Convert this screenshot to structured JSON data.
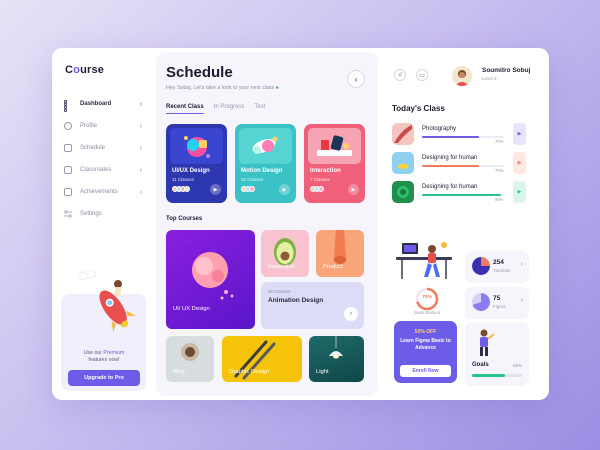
{
  "app": {
    "logo_prefix": "C",
    "logo_o": "o",
    "logo_suffix": "urse"
  },
  "sidebar": {
    "items": [
      {
        "label": "Dashboard",
        "icon": "dashboard-icon",
        "active": true
      },
      {
        "label": "Profile",
        "icon": "profile-icon"
      },
      {
        "label": "Schedule",
        "icon": "calendar-icon"
      },
      {
        "label": "Classmates",
        "icon": "users-icon"
      },
      {
        "label": "Achievements",
        "icon": "trophy-icon"
      },
      {
        "label": "Settings",
        "icon": "settings-icon"
      }
    ],
    "promo": {
      "text_before": "Use our ",
      "highlight": "Premium",
      "text_after": "features now!",
      "button": "Upgrade to Pro"
    }
  },
  "schedule": {
    "title": "Schedule",
    "subtitle": "Hey Sobuj, Let's take a look to your next class",
    "back_icon": "chevron-left-icon",
    "tabs": [
      "Recent Class",
      "In Progress",
      "Test"
    ],
    "recent_classes": [
      {
        "name": "UI/UX Design",
        "sub": "11 Classes",
        "color": "#2d37b0"
      },
      {
        "name": "Motion Design",
        "sub": "32 Classes",
        "color": "#3ac2c6"
      },
      {
        "name": "Interaction",
        "sub": "7 Classes",
        "color": "#f0607a"
      }
    ],
    "top_courses_title": "Top Courses",
    "top_courses": [
      {
        "label": "UI/ UX Design"
      },
      {
        "label": "Inspiration"
      },
      {
        "label": "Product"
      },
      {
        "small": "50 Classes",
        "label": "Animation Design"
      },
      {
        "label": "Blog"
      },
      {
        "label": "Graphic Design"
      },
      {
        "label": "Light"
      }
    ]
  },
  "header": {
    "notification_icon": "bell-icon",
    "message_icon": "chat-icon",
    "user_name": "Soumitro Sobuj",
    "user_level": "Level 3"
  },
  "today": {
    "title": "Today's Class",
    "classes": [
      {
        "name": "Photography",
        "progress": 70,
        "pct_label": "70%",
        "color": "#6c5ce7",
        "play_bg": "#e8e4fb"
      },
      {
        "name": "Designing for human",
        "progress": 70,
        "pct_label": "70%",
        "color": "#f07b5c",
        "play_bg": "#fde8e2"
      },
      {
        "name": "Designing for human",
        "progress": 96,
        "pct_label": "96%",
        "color": "#27c38a",
        "play_bg": "#dcf5ea"
      }
    ]
  },
  "stats": {
    "seats_pct": "70%",
    "seats_label": "Seats Booked",
    "tutorials_value": "254",
    "tutorials_label": "Tutorials",
    "figma_value": "75",
    "figma_label": "Figma",
    "goals_label": "Goals",
    "goals_pct": "65%",
    "goals_progress": 65
  },
  "figma_promo": {
    "off": "50% OFF",
    "headline": "Learn Figma Basic to Advance",
    "button": "Enroll Now"
  }
}
